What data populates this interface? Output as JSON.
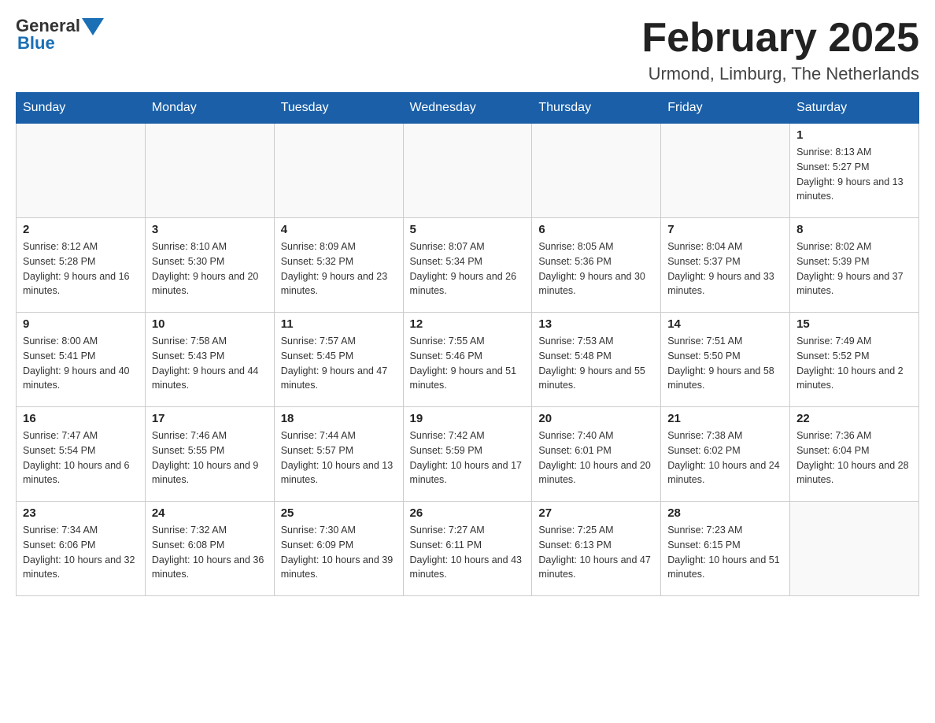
{
  "header": {
    "logo_general": "General",
    "logo_blue": "Blue",
    "month_title": "February 2025",
    "location": "Urmond, Limburg, The Netherlands"
  },
  "weekdays": [
    "Sunday",
    "Monday",
    "Tuesday",
    "Wednesday",
    "Thursday",
    "Friday",
    "Saturday"
  ],
  "weeks": [
    [
      {
        "day": "",
        "sunrise": "",
        "sunset": "",
        "daylight": ""
      },
      {
        "day": "",
        "sunrise": "",
        "sunset": "",
        "daylight": ""
      },
      {
        "day": "",
        "sunrise": "",
        "sunset": "",
        "daylight": ""
      },
      {
        "day": "",
        "sunrise": "",
        "sunset": "",
        "daylight": ""
      },
      {
        "day": "",
        "sunrise": "",
        "sunset": "",
        "daylight": ""
      },
      {
        "day": "",
        "sunrise": "",
        "sunset": "",
        "daylight": ""
      },
      {
        "day": "1",
        "sunrise": "Sunrise: 8:13 AM",
        "sunset": "Sunset: 5:27 PM",
        "daylight": "Daylight: 9 hours and 13 minutes."
      }
    ],
    [
      {
        "day": "2",
        "sunrise": "Sunrise: 8:12 AM",
        "sunset": "Sunset: 5:28 PM",
        "daylight": "Daylight: 9 hours and 16 minutes."
      },
      {
        "day": "3",
        "sunrise": "Sunrise: 8:10 AM",
        "sunset": "Sunset: 5:30 PM",
        "daylight": "Daylight: 9 hours and 20 minutes."
      },
      {
        "day": "4",
        "sunrise": "Sunrise: 8:09 AM",
        "sunset": "Sunset: 5:32 PM",
        "daylight": "Daylight: 9 hours and 23 minutes."
      },
      {
        "day": "5",
        "sunrise": "Sunrise: 8:07 AM",
        "sunset": "Sunset: 5:34 PM",
        "daylight": "Daylight: 9 hours and 26 minutes."
      },
      {
        "day": "6",
        "sunrise": "Sunrise: 8:05 AM",
        "sunset": "Sunset: 5:36 PM",
        "daylight": "Daylight: 9 hours and 30 minutes."
      },
      {
        "day": "7",
        "sunrise": "Sunrise: 8:04 AM",
        "sunset": "Sunset: 5:37 PM",
        "daylight": "Daylight: 9 hours and 33 minutes."
      },
      {
        "day": "8",
        "sunrise": "Sunrise: 8:02 AM",
        "sunset": "Sunset: 5:39 PM",
        "daylight": "Daylight: 9 hours and 37 minutes."
      }
    ],
    [
      {
        "day": "9",
        "sunrise": "Sunrise: 8:00 AM",
        "sunset": "Sunset: 5:41 PM",
        "daylight": "Daylight: 9 hours and 40 minutes."
      },
      {
        "day": "10",
        "sunrise": "Sunrise: 7:58 AM",
        "sunset": "Sunset: 5:43 PM",
        "daylight": "Daylight: 9 hours and 44 minutes."
      },
      {
        "day": "11",
        "sunrise": "Sunrise: 7:57 AM",
        "sunset": "Sunset: 5:45 PM",
        "daylight": "Daylight: 9 hours and 47 minutes."
      },
      {
        "day": "12",
        "sunrise": "Sunrise: 7:55 AM",
        "sunset": "Sunset: 5:46 PM",
        "daylight": "Daylight: 9 hours and 51 minutes."
      },
      {
        "day": "13",
        "sunrise": "Sunrise: 7:53 AM",
        "sunset": "Sunset: 5:48 PM",
        "daylight": "Daylight: 9 hours and 55 minutes."
      },
      {
        "day": "14",
        "sunrise": "Sunrise: 7:51 AM",
        "sunset": "Sunset: 5:50 PM",
        "daylight": "Daylight: 9 hours and 58 minutes."
      },
      {
        "day": "15",
        "sunrise": "Sunrise: 7:49 AM",
        "sunset": "Sunset: 5:52 PM",
        "daylight": "Daylight: 10 hours and 2 minutes."
      }
    ],
    [
      {
        "day": "16",
        "sunrise": "Sunrise: 7:47 AM",
        "sunset": "Sunset: 5:54 PM",
        "daylight": "Daylight: 10 hours and 6 minutes."
      },
      {
        "day": "17",
        "sunrise": "Sunrise: 7:46 AM",
        "sunset": "Sunset: 5:55 PM",
        "daylight": "Daylight: 10 hours and 9 minutes."
      },
      {
        "day": "18",
        "sunrise": "Sunrise: 7:44 AM",
        "sunset": "Sunset: 5:57 PM",
        "daylight": "Daylight: 10 hours and 13 minutes."
      },
      {
        "day": "19",
        "sunrise": "Sunrise: 7:42 AM",
        "sunset": "Sunset: 5:59 PM",
        "daylight": "Daylight: 10 hours and 17 minutes."
      },
      {
        "day": "20",
        "sunrise": "Sunrise: 7:40 AM",
        "sunset": "Sunset: 6:01 PM",
        "daylight": "Daylight: 10 hours and 20 minutes."
      },
      {
        "day": "21",
        "sunrise": "Sunrise: 7:38 AM",
        "sunset": "Sunset: 6:02 PM",
        "daylight": "Daylight: 10 hours and 24 minutes."
      },
      {
        "day": "22",
        "sunrise": "Sunrise: 7:36 AM",
        "sunset": "Sunset: 6:04 PM",
        "daylight": "Daylight: 10 hours and 28 minutes."
      }
    ],
    [
      {
        "day": "23",
        "sunrise": "Sunrise: 7:34 AM",
        "sunset": "Sunset: 6:06 PM",
        "daylight": "Daylight: 10 hours and 32 minutes."
      },
      {
        "day": "24",
        "sunrise": "Sunrise: 7:32 AM",
        "sunset": "Sunset: 6:08 PM",
        "daylight": "Daylight: 10 hours and 36 minutes."
      },
      {
        "day": "25",
        "sunrise": "Sunrise: 7:30 AM",
        "sunset": "Sunset: 6:09 PM",
        "daylight": "Daylight: 10 hours and 39 minutes."
      },
      {
        "day": "26",
        "sunrise": "Sunrise: 7:27 AM",
        "sunset": "Sunset: 6:11 PM",
        "daylight": "Daylight: 10 hours and 43 minutes."
      },
      {
        "day": "27",
        "sunrise": "Sunrise: 7:25 AM",
        "sunset": "Sunset: 6:13 PM",
        "daylight": "Daylight: 10 hours and 47 minutes."
      },
      {
        "day": "28",
        "sunrise": "Sunrise: 7:23 AM",
        "sunset": "Sunset: 6:15 PM",
        "daylight": "Daylight: 10 hours and 51 minutes."
      },
      {
        "day": "",
        "sunrise": "",
        "sunset": "",
        "daylight": ""
      }
    ]
  ]
}
